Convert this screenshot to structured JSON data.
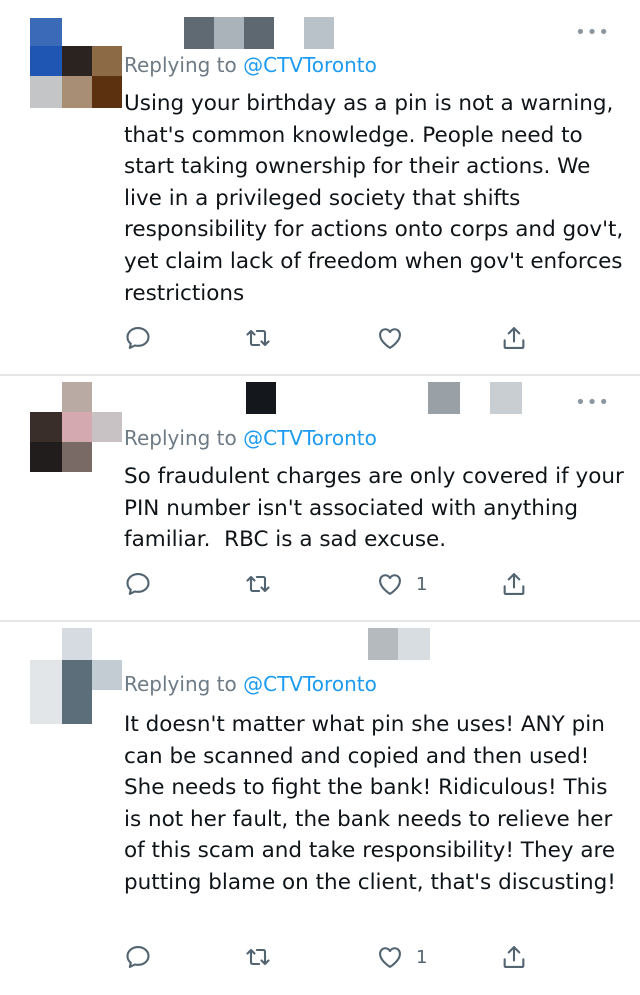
{
  "tweets": [
    {
      "reply_prefix": "Replying to ",
      "reply_handle": "@CTVToronto",
      "text": "Using your birthday as a pin is not a warning, that's common knowledge. People need to start taking ownership for their actions. We live in a privileged society that shifts responsibility for actions onto corps and gov't, yet claim lack of freedom when gov't enforces restrictions",
      "like_count": "",
      "avatar_colors": [
        "#3a6ab8",
        "#1f56b4",
        "#2a2320",
        "#8b6a45",
        "#c3c5c6",
        "#a88e75",
        "#5b3110"
      ],
      "name_colors": [
        "#606a72",
        "#aab3ba",
        "#5e6870",
        "#bac2c9"
      ]
    },
    {
      "reply_prefix": "Replying to ",
      "reply_handle": "@CTVToronto",
      "text": "So fraudulent charges are only covered if your PIN number isn't associated with anything familiar.  RBC is a sad excuse.",
      "like_count": "1",
      "avatar_colors": [
        "#b9aaa4",
        "#d5a9b0",
        "#3a2e2a",
        "#211d1c",
        "#7a6a66",
        "#c8c2c4"
      ],
      "name_colors": [
        "#14171c",
        "#9aa1a6",
        "#c9ced2"
      ]
    },
    {
      "reply_prefix": "Replying to ",
      "reply_handle": "@CTVToronto",
      "text": "It doesn't matter what pin she uses! ANY pin can be scanned and copied and then used! She needs to fight the bank! Ridiculous! This is not her fault, the bank needs to relieve her of this scam and take responsibility! They are putting blame on the client, that's discusting!",
      "like_count": "1",
      "avatar_colors": [
        "#d5dbe0",
        "#5d6e7b",
        "#c4ccd3",
        "#e2e6e9"
      ],
      "name_colors": [
        "#b4babe",
        "#d7dde1"
      ]
    }
  ],
  "icons": {
    "reply": "reply-icon",
    "retweet": "retweet-icon",
    "like": "heart-icon",
    "share": "share-icon",
    "more": "more-icon"
  },
  "more_glyph": "•••"
}
